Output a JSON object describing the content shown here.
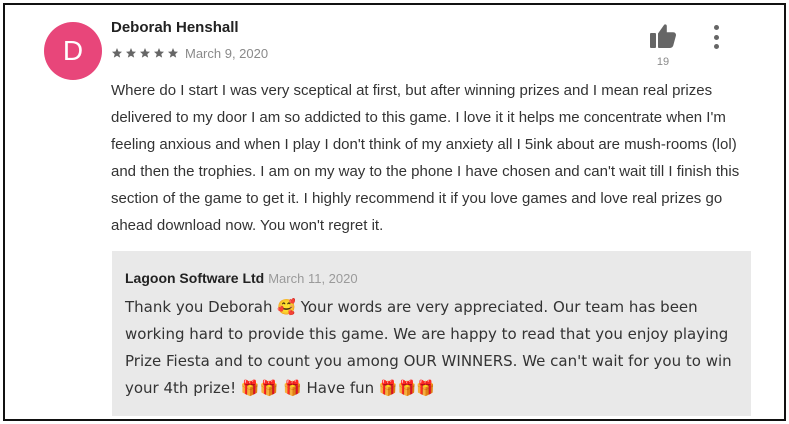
{
  "review": {
    "avatar_letter": "D",
    "avatar_color": "#e8467a",
    "author": "Deborah Henshall",
    "rating": 5,
    "date": "March 9, 2020",
    "helpful_count": "19",
    "thumb_icon": "thumbs-up-icon",
    "more_icon": "more-vert-icon",
    "text": "Where do I start I was very sceptical at first, but after winning prizes and I mean real prizes delivered to my door I am so addicted to this game. I love it it helps me concentrate when I'm feeling anxious and when I play I don't think of my anxiety all I 5ink about are mush-rooms (lol) and then the trophies. I am on my way to the phone I have chosen and can't wait till I finish this section of the game to get it. I highly recommend it if you love games and love real prizes go ahead download now. You won't regret it."
  },
  "reply": {
    "author": "Lagoon Software Ltd",
    "date": "March 11, 2020",
    "text": "Thank you Deborah 🥰 Your words are very appreciated. Our team has been working hard to provide this game. We are happy to read that you enjoy playing Prize Fiesta and to count you among OUR WINNERS. We can't wait for you to win your 4th prize! 🎁🎁 🎁 Have fun 🎁🎁🎁"
  },
  "colors": {
    "star": "#666666",
    "reply_background": "#e9e9e9"
  }
}
